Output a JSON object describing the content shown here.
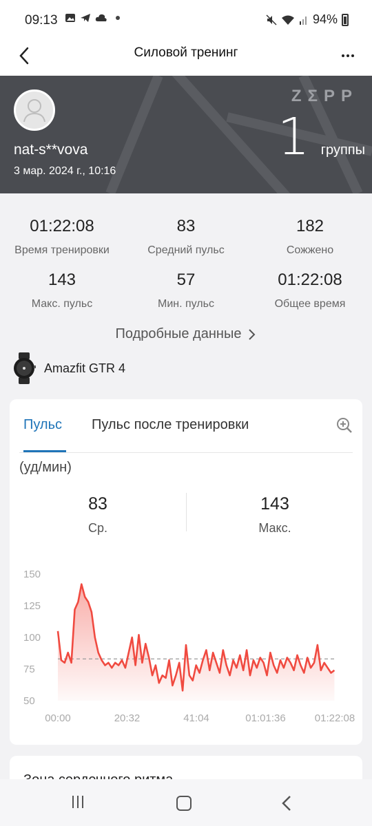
{
  "status_bar": {
    "time": "09:13",
    "battery": "94%"
  },
  "app_bar": {
    "title": "Силовой тренинг"
  },
  "hero": {
    "username": "nat-s**vova",
    "datetime": "3 мар. 2024 г., 10:16",
    "brand": "ZΣPP",
    "groups_count": "1",
    "groups_label": "группы"
  },
  "stats": [
    {
      "value": "01:22:08",
      "label": "Время тренировки"
    },
    {
      "value": "83",
      "label": "Средний пульс"
    },
    {
      "value": "182",
      "label": "Сожжено"
    },
    {
      "value": "143",
      "label": "Макс. пульс"
    },
    {
      "value": "57",
      "label": "Мин. пульс"
    },
    {
      "value": "01:22:08",
      "label": "Общее время"
    }
  ],
  "details_link": "Подробные данные",
  "device": {
    "name": "Amazfit GTR 4"
  },
  "heart_card": {
    "tabs": [
      "Пульс",
      "Пульс после тренировки"
    ],
    "unit": "(уд/мин)",
    "avg": {
      "value": "83",
      "label": "Ср."
    },
    "max": {
      "value": "143",
      "label": "Макс."
    }
  },
  "next_card": {
    "title": "Зона сердечного ритма"
  },
  "colors": {
    "accent": "#1f74b8",
    "line": "#f04a40",
    "hero_bg": "#4a4c51"
  },
  "chart_data": {
    "type": "area",
    "x_ticks": [
      "00:00",
      "20:32",
      "41:04",
      "01:01:36",
      "01:22:08"
    ],
    "y_ticks": [
      "150",
      "125",
      "100",
      "75",
      "50"
    ],
    "ylim": [
      50,
      150
    ],
    "xlim_minutes": [
      0,
      82.13
    ],
    "average": 83,
    "x": [
      0,
      1,
      2,
      3,
      4,
      5,
      6,
      7,
      8,
      9,
      10,
      11,
      12,
      13,
      14,
      15,
      16,
      17,
      18,
      19,
      20,
      21,
      22,
      23,
      24,
      25,
      26,
      27,
      28,
      29,
      30,
      31,
      32,
      33,
      34,
      35,
      36,
      37,
      38,
      39,
      40,
      41,
      42,
      43,
      44,
      45,
      46,
      47,
      48,
      49,
      50,
      51,
      52,
      53,
      54,
      55,
      56,
      57,
      58,
      59,
      60,
      61,
      62,
      63,
      64,
      65,
      66,
      67,
      68,
      69,
      70,
      71,
      72,
      73,
      74,
      75,
      76,
      77,
      78,
      79,
      80,
      81,
      82
    ],
    "values": [
      105,
      82,
      80,
      88,
      80,
      122,
      128,
      142,
      132,
      128,
      120,
      100,
      88,
      82,
      78,
      80,
      76,
      80,
      78,
      82,
      76,
      88,
      100,
      78,
      102,
      80,
      95,
      84,
      70,
      78,
      64,
      70,
      68,
      82,
      62,
      70,
      80,
      58,
      94,
      70,
      66,
      78,
      72,
      82,
      90,
      74,
      88,
      80,
      72,
      90,
      78,
      70,
      82,
      76,
      86,
      74,
      90,
      70,
      82,
      76,
      84,
      80,
      70,
      88,
      78,
      72,
      82,
      76,
      84,
      80,
      74,
      86,
      78,
      72,
      84,
      76,
      80,
      94,
      74,
      80,
      76,
      72,
      74
    ]
  }
}
